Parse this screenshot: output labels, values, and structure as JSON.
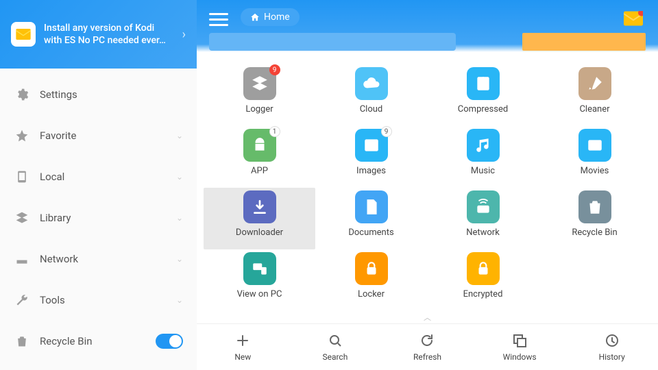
{
  "promo": {
    "line1": "Install any version of Kodi",
    "line2": "with ES No PC needed ever…"
  },
  "sidebar": {
    "items": [
      {
        "label": "Settings",
        "icon": "gear-icon",
        "chevron": false,
        "toggle": false
      },
      {
        "label": "Favorite",
        "icon": "star-icon",
        "chevron": true,
        "toggle": false
      },
      {
        "label": "Local",
        "icon": "phone-icon",
        "chevron": true,
        "toggle": false
      },
      {
        "label": "Library",
        "icon": "layers-icon",
        "chevron": true,
        "toggle": false
      },
      {
        "label": "Network",
        "icon": "router-icon",
        "chevron": true,
        "toggle": false
      },
      {
        "label": "Tools",
        "icon": "wrench-icon",
        "chevron": true,
        "toggle": false
      },
      {
        "label": "Recycle Bin",
        "icon": "trash-icon",
        "chevron": false,
        "toggle": true
      }
    ]
  },
  "header": {
    "location": "Home"
  },
  "grid": [
    {
      "label": "Logger",
      "icon": "layers",
      "color": "#9e9e9e",
      "badge": "9",
      "badge_style": "red"
    },
    {
      "label": "Cloud",
      "icon": "cloud",
      "color": "#4fc3f7"
    },
    {
      "label": "Compressed",
      "icon": "zip",
      "color": "#29b6f6"
    },
    {
      "label": "Cleaner",
      "icon": "brush",
      "color": "#c8a888"
    },
    {
      "label": "APP",
      "icon": "android",
      "color": "#66bb6a",
      "badge": "1",
      "badge_style": "white"
    },
    {
      "label": "Images",
      "icon": "image",
      "color": "#29b6f6",
      "badge": "9",
      "badge_style": "white"
    },
    {
      "label": "Music",
      "icon": "music",
      "color": "#29b6f6"
    },
    {
      "label": "Movies",
      "icon": "movie",
      "color": "#29b6f6"
    },
    {
      "label": "Downloader",
      "icon": "download",
      "color": "#5c6bc0",
      "selected": true
    },
    {
      "label": "Documents",
      "icon": "doc",
      "color": "#42a5f5"
    },
    {
      "label": "Network",
      "icon": "wifi",
      "color": "#4db6ac"
    },
    {
      "label": "Recycle Bin",
      "icon": "trash",
      "color": "#78909c"
    },
    {
      "label": "View on PC",
      "icon": "devices",
      "color": "#26a69a"
    },
    {
      "label": "Locker",
      "icon": "lock",
      "color": "#ff9800"
    },
    {
      "label": "Encrypted",
      "icon": "key",
      "color": "#ffb300"
    }
  ],
  "bottom": [
    {
      "label": "New",
      "icon": "plus"
    },
    {
      "label": "Search",
      "icon": "search"
    },
    {
      "label": "Refresh",
      "icon": "refresh"
    },
    {
      "label": "Windows",
      "icon": "windows"
    },
    {
      "label": "History",
      "icon": "history"
    }
  ]
}
